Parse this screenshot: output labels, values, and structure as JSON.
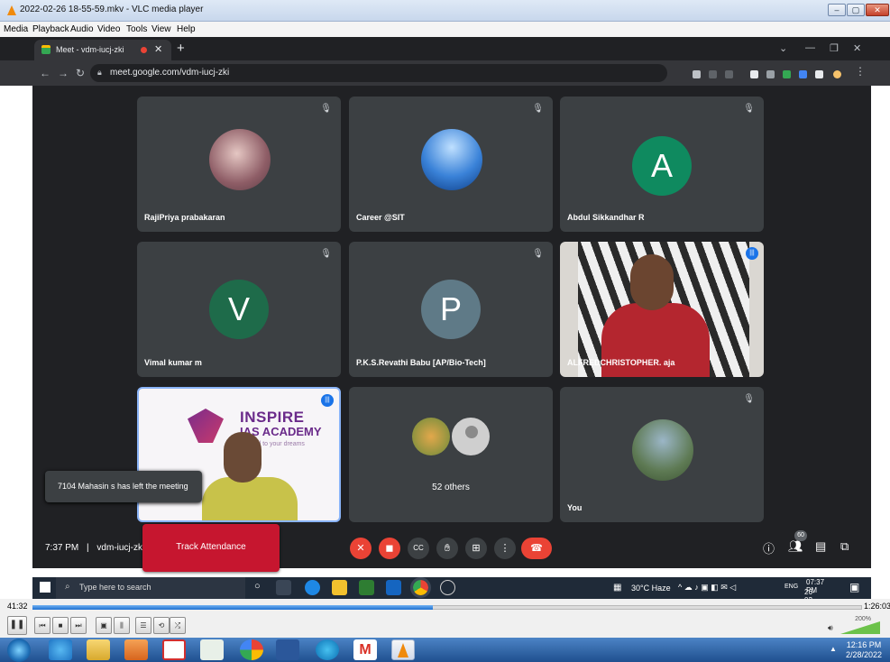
{
  "vlc": {
    "title": "2022-02-26 18-55-59.mkv - VLC media player",
    "menu": [
      "Media",
      "Playback",
      "Audio",
      "Video",
      "Tools",
      "View",
      "Help"
    ],
    "time_current": "41:32",
    "time_total": "1:26:03",
    "progress": 0.48,
    "volume_label": "200%"
  },
  "browser": {
    "tab_title": "Meet - vdm-iucj-zki",
    "url": "meet.google.com/vdm-iucj-zki"
  },
  "meet": {
    "tiles": [
      {
        "name": "RajiPriya prabakaran",
        "kind": "photo",
        "color": "#c9a6a0"
      },
      {
        "name": "Career @SIT",
        "kind": "photo",
        "color": "#2b6fd6"
      },
      {
        "name": "Abdul Sikkandhar R",
        "kind": "letter",
        "letter": "A",
        "color": "#0f8a5f"
      },
      {
        "name": "Vimal kumar m",
        "kind": "letter",
        "letter": "V",
        "color": "#1e6b4a"
      },
      {
        "name": "P.K.S.Revathi Babu [AP/Bio-Tech]",
        "kind": "letter",
        "letter": "P",
        "color": "#5f7a87"
      },
      {
        "name": "ALFREDCHRISTOPHER. aja",
        "kind": "video",
        "color": "#b4262f"
      },
      {
        "name": "",
        "kind": "inspire",
        "brand": "INSPIRE",
        "brand2": "IAS ACADEMY",
        "tagline": "fuel to your dreams"
      },
      {
        "name": "52 others",
        "kind": "others"
      },
      {
        "name": "You",
        "kind": "photo-you",
        "color": "#6f8a9a"
      }
    ],
    "toast": "7104 Mahasin s has left the meeting",
    "clock": "7:37 PM",
    "meeting_code": "vdm-iucj-zki",
    "track_button": "Track Attendance",
    "participants_count": "60"
  },
  "inner_taskbar": {
    "search_placeholder": "Type here to search",
    "weather": "30°C Haze",
    "lang": "ENG",
    "time": "07:37 PM",
    "date": "26-02-2022"
  },
  "outer_taskbar": {
    "time": "12:16 PM",
    "date": "2/28/2022"
  }
}
